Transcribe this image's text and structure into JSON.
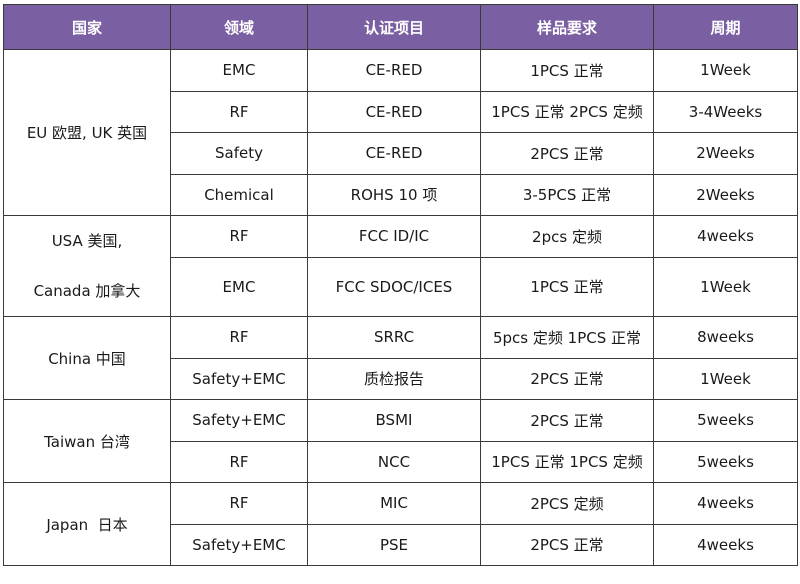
{
  "colors": {
    "header_bg": "#7b5fa3",
    "header_text": "#ffffff",
    "border": "#3a3a3a"
  },
  "headers": {
    "country": "国家",
    "field": "领域",
    "cert": "认证项目",
    "sample": "样品要求",
    "period": "周期"
  },
  "groups": [
    {
      "country": "EU 欧盟, UK 英国",
      "rows": [
        {
          "field": "EMC",
          "cert": "CE-RED",
          "sample": "1PCS 正常",
          "period": "1Week"
        },
        {
          "field": "RF",
          "cert": "CE-RED",
          "sample": "1PCS 正常 2PCS 定频",
          "period": "3-4Weeks"
        },
        {
          "field": "Safety",
          "cert": "CE-RED",
          "sample": "2PCS 正常",
          "period": "2Weeks"
        },
        {
          "field": "Chemical",
          "cert": "ROHS 10 项",
          "sample": "3-5PCS 正常",
          "period": "2Weeks"
        }
      ]
    },
    {
      "country_line1": "USA 美国,",
      "country_line2": "Canada 加拿大",
      "rows": [
        {
          "field": "RF",
          "cert": "FCC ID/IC",
          "sample": "2pcs 定频",
          "period": "4weeks"
        },
        {
          "field": "EMC",
          "cert": "FCC SDOC/ICES",
          "sample": "1PCS 正常",
          "period": "1Week"
        }
      ]
    },
    {
      "country": "China 中国",
      "rows": [
        {
          "field": "RF",
          "cert": "SRRC",
          "sample": "5pcs 定频 1PCS 正常",
          "period": "8weeks"
        },
        {
          "field": "Safety+EMC",
          "cert": "质检报告",
          "sample": "2PCS 正常",
          "period": "1Week"
        }
      ]
    },
    {
      "country": "Taiwan 台湾",
      "rows": [
        {
          "field": "Safety+EMC",
          "cert": "BSMI",
          "sample": "2PCS 正常",
          "period": "5weeks"
        },
        {
          "field": "RF",
          "cert": "NCC",
          "sample": "1PCS 正常 1PCS 定频",
          "period": "5weeks"
        }
      ]
    },
    {
      "country": "Japan  日本",
      "rows": [
        {
          "field": "RF",
          "cert": "MIC",
          "sample": "2PCS 定频",
          "period": "4weeks"
        },
        {
          "field": "Safety+EMC",
          "cert": "PSE",
          "sample": "2PCS 正常",
          "period": "4weeks"
        }
      ]
    }
  ]
}
